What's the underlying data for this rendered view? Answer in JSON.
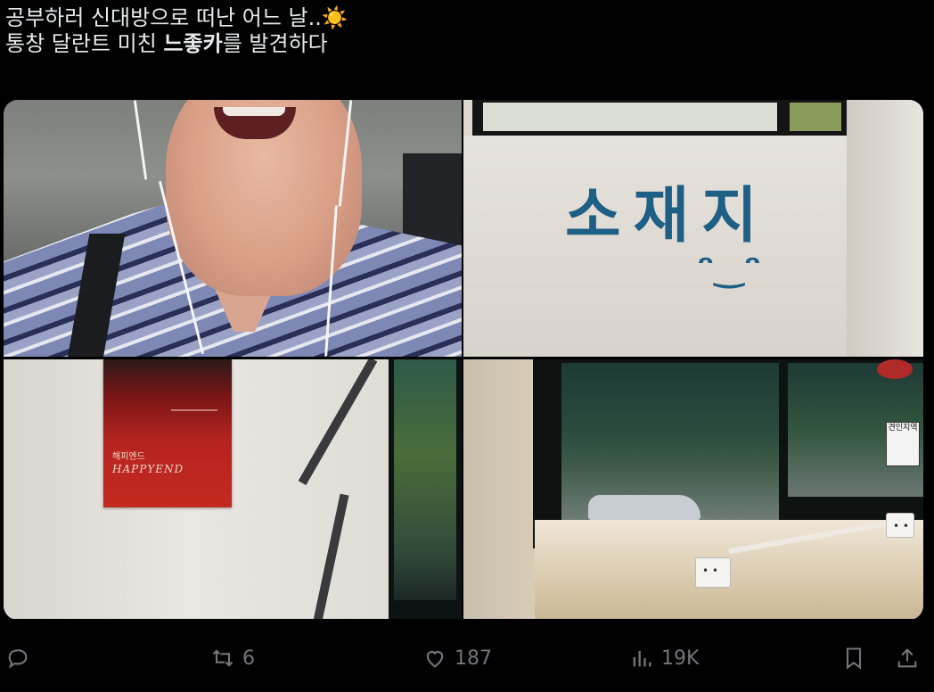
{
  "tweet": {
    "line1": "공부하러 신대방으로 떠난 어느 날..",
    "line1_emoji": "☀️",
    "line2_pre": "통창 달란트 미친 ",
    "line2_bold": "느좋카",
    "line2_post": "를 발견하다"
  },
  "media": {
    "graffiti_text": "소재지",
    "graffiti_face": "ᵔ‿ᵔ",
    "poster_title": "HAPPYEND",
    "poster_korean": "해피엔드",
    "street_sign": "견인지역"
  },
  "actions": {
    "reply_count": "",
    "retweet_count": "6",
    "like_count": "187",
    "views_count": "19K"
  },
  "colors": {
    "background": "#000000",
    "text": "#e7e9ea",
    "muted": "#71767b",
    "graffiti": "#1e5f86"
  }
}
